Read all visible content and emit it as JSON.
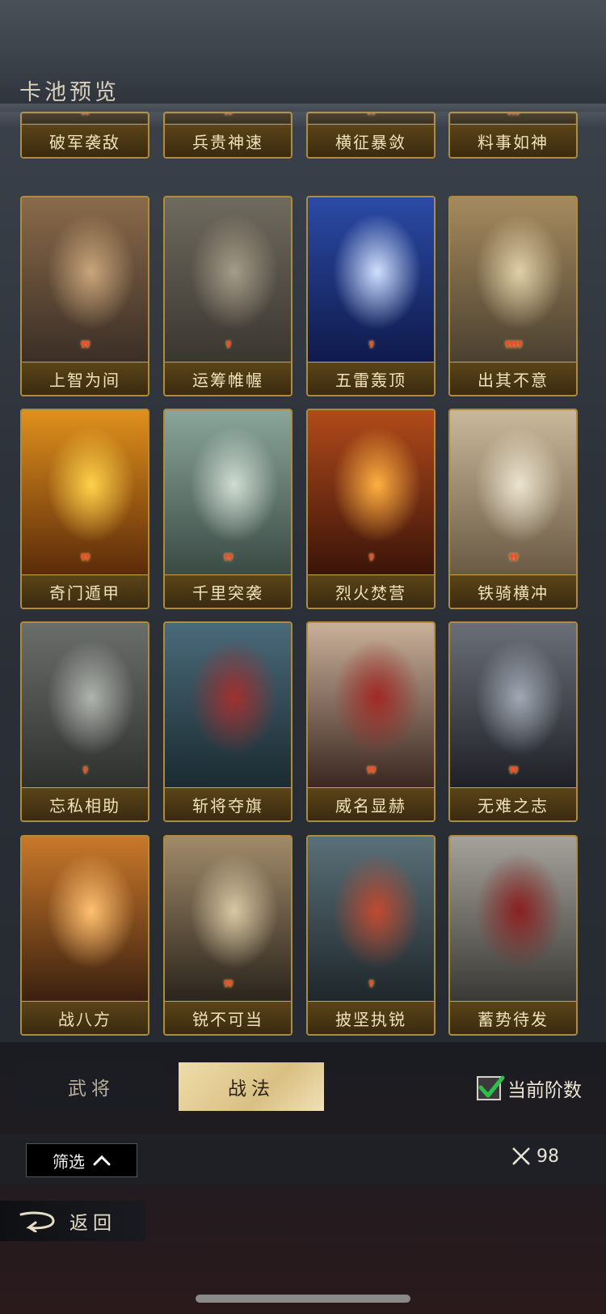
{
  "header": {
    "title": "卡池预览"
  },
  "partial_row": [
    {
      "name": "破军袭敌",
      "pips": 2
    },
    {
      "name": "兵贵神速",
      "pips": 2
    },
    {
      "name": "横征暴敛",
      "pips": 2
    },
    {
      "name": "料事如神",
      "pips": 3
    }
  ],
  "cards": [
    {
      "name": "上智为间",
      "pips": 2,
      "colors": [
        "#8a6a4a",
        "#3a2e26",
        "#c9a57a"
      ]
    },
    {
      "name": "运筹帷幄",
      "pips": 1,
      "colors": [
        "#6f6a5e",
        "#3a3630",
        "#a59c88"
      ]
    },
    {
      "name": "五雷轰顶",
      "pips": 1,
      "colors": [
        "#2b4aa6",
        "#0f1a4a",
        "#cfe0ff"
      ]
    },
    {
      "name": "出其不意",
      "pips": 4,
      "colors": [
        "#a58a5e",
        "#4a4030",
        "#e0d0a8"
      ]
    },
    {
      "name": "奇门遁甲",
      "pips": 2,
      "colors": [
        "#e0901c",
        "#5a2a0a",
        "#ffd24a"
      ]
    },
    {
      "name": "千里突袭",
      "pips": 2,
      "colors": [
        "#8aa59a",
        "#3a4a44",
        "#d0dcd2"
      ]
    },
    {
      "name": "烈火焚营",
      "pips": 1,
      "colors": [
        "#b04a1a",
        "#3a140a",
        "#ffb040"
      ]
    },
    {
      "name": "铁骑横冲",
      "pips": 2,
      "colors": [
        "#c9b89a",
        "#6a5a44",
        "#ece4d0"
      ]
    },
    {
      "name": "忘私相助",
      "pips": 1,
      "colors": [
        "#6a6e6a",
        "#2e302e",
        "#b0b4ae"
      ]
    },
    {
      "name": "斩将夺旗",
      "pips": 0,
      "colors": [
        "#4a6a7a",
        "#1a2a30",
        "#a03030"
      ]
    },
    {
      "name": "威名显赫",
      "pips": 2,
      "colors": [
        "#c9b09a",
        "#3a2620",
        "#a02a24"
      ]
    },
    {
      "name": "无难之志",
      "pips": 2,
      "colors": [
        "#6a6e76",
        "#1e2026",
        "#a0a8b4"
      ]
    },
    {
      "name": "战八方",
      "pips": 0,
      "colors": [
        "#c9782a",
        "#3a2010",
        "#ffc070"
      ]
    },
    {
      "name": "锐不可当",
      "pips": 2,
      "colors": [
        "#a08a6a",
        "#2a241c",
        "#d8c8a4"
      ]
    },
    {
      "name": "披坚执锐",
      "pips": 1,
      "colors": [
        "#5a7078",
        "#1e262a",
        "#c04a30"
      ]
    },
    {
      "name": "蓄势待发",
      "pips": 0,
      "colors": [
        "#a4a29a",
        "#3a3834",
        "#8a2020"
      ]
    }
  ],
  "tabs": {
    "generals": "武将",
    "tactics": "战法"
  },
  "filter": {
    "current_tier_label": "当前阶数",
    "current_tier_checked": true,
    "filter_label": "筛选"
  },
  "counter": {
    "value": "98"
  },
  "nav": {
    "back_label": "返回"
  }
}
